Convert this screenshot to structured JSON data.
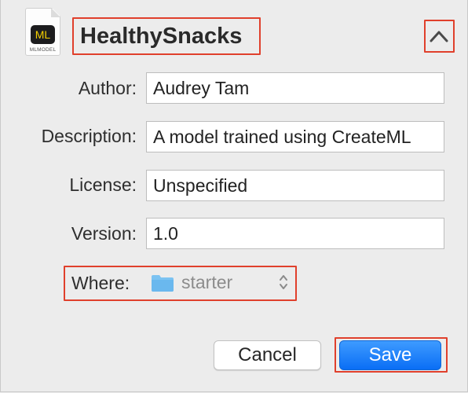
{
  "model": {
    "file_icon_badge": "ML",
    "file_icon_caption": "MLMODEL",
    "name": "HealthySnacks"
  },
  "fields": {
    "author_label": "Author:",
    "author_value": "Audrey Tam",
    "description_label": "Description:",
    "description_value": "A model trained using CreateML",
    "license_label": "License:",
    "license_value": "Unspecified",
    "version_label": "Version:",
    "version_value": "1.0"
  },
  "where": {
    "label": "Where:",
    "value": "starter"
  },
  "buttons": {
    "cancel": "Cancel",
    "save": "Save"
  },
  "colors": {
    "highlight": "#e0402c",
    "accent": "#0a6ef5",
    "folder": "#6ab8ee"
  },
  "icons": [
    "mlmodel-file-icon",
    "chevron-up-icon",
    "folder-icon",
    "stepper-icon"
  ]
}
